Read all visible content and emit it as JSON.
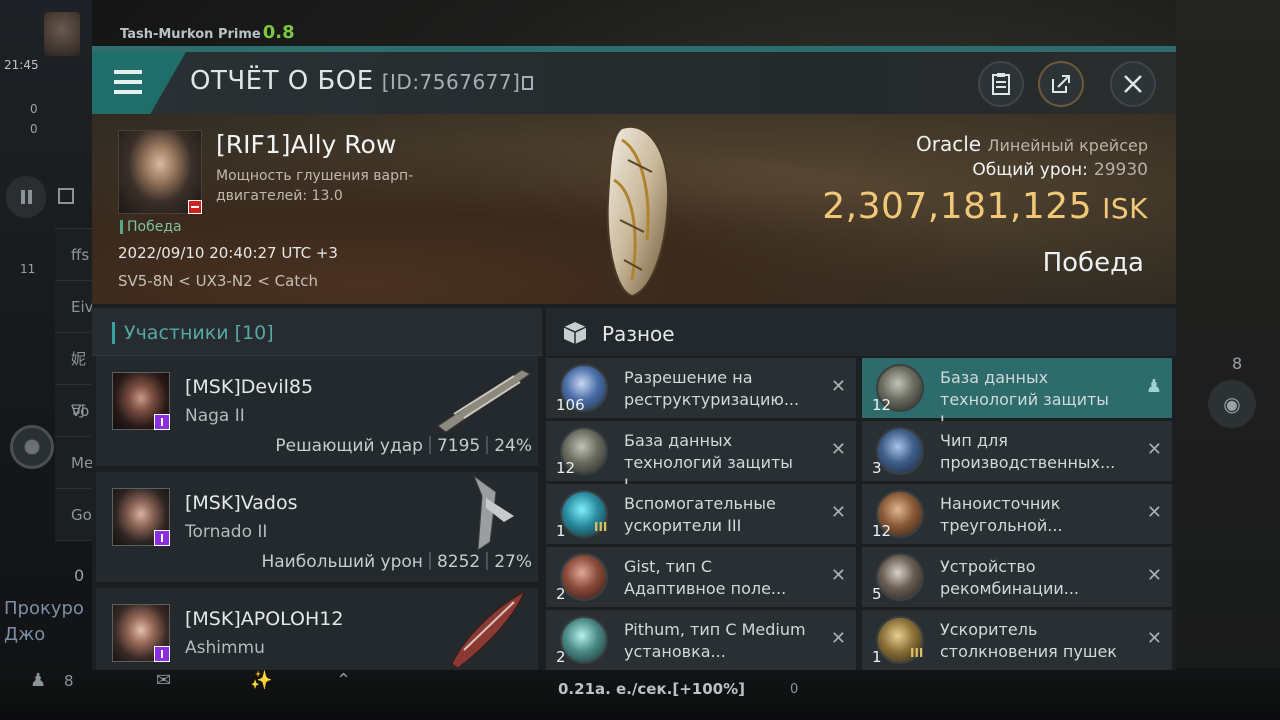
{
  "background": {
    "system_name": "Tash-Murkon Prime",
    "security": "0.8",
    "clock": "21:45",
    "counters": [
      "0",
      "0"
    ],
    "sidebar_items": [
      "ffs",
      "Eiv",
      "妮可",
      "Vo",
      "Me",
      "Go"
    ],
    "left_badge": "11",
    "chat_lines": [
      "Прокуро",
      "Джо"
    ],
    "chat_count": "0",
    "bottom_count": "8",
    "right_count": "8",
    "speed": "0.21а. е./сек.[+100%]",
    "speed_zero": "0"
  },
  "header": {
    "title": "ОТЧЁТ О БОЕ",
    "report_id": "[ID:7567677]"
  },
  "victim": {
    "name": "[RIF1]Ally Row",
    "attribute": "Мощность глушения варп-двигателей: 13.0",
    "outcome_tag": "Победа",
    "datetime": "2022/09/10 20:40:27 UTC +3",
    "location": "SV5-8N < UX3-N2 < Catch",
    "ship_name": "Oracle",
    "ship_type": "Линейный крейсер",
    "damage_label": "Общий урон:",
    "damage_value": "29930",
    "isk_value": "2,307,181,125",
    "isk_unit": "ISK",
    "result": "Победа"
  },
  "participants": {
    "title": "Участники",
    "count": "[10]",
    "list": [
      {
        "name": "[MSK]Devil85",
        "ship": "Naga II",
        "label": "Решающий удар",
        "damage": "7195",
        "percent": "24%"
      },
      {
        "name": "[MSK]Vados",
        "ship": "Tornado II",
        "label": "Наибольший урон",
        "damage": "8252",
        "percent": "27%"
      },
      {
        "name": "[MSK]APOLOH12",
        "ship": "Ashimmu",
        "label": "",
        "damage": "",
        "percent": ""
      }
    ]
  },
  "misc": {
    "title": "Разное",
    "items": [
      {
        "qty": "106",
        "name": "Разрешение на реструктуризацию...",
        "action": "✕",
        "level": ""
      },
      {
        "qty": "12",
        "name": "База данных технологий защиты I...",
        "action": "person",
        "level": ""
      },
      {
        "qty": "12",
        "name": "База данных технологий защиты I...",
        "action": "✕",
        "level": ""
      },
      {
        "qty": "3",
        "name": "Чип для производственных...",
        "action": "✕",
        "level": ""
      },
      {
        "qty": "1",
        "name": "Вспомогательные ускорители III",
        "action": "✕",
        "level": "III"
      },
      {
        "qty": "12",
        "name": "Наноисточник треугольной...",
        "action": "✕",
        "level": ""
      },
      {
        "qty": "2",
        "name": "Gist, тип C Адаптивное поле...",
        "action": "✕",
        "level": ""
      },
      {
        "qty": "5",
        "name": "Устройство рекомбинации...",
        "action": "✕",
        "level": ""
      },
      {
        "qty": "2",
        "name": "Pithum, тип C Medium установка...",
        "action": "✕",
        "level": ""
      },
      {
        "qty": "1",
        "name": "Ускоритель столкновения пушек ...",
        "action": "✕",
        "level": "III"
      }
    ]
  },
  "colors": {
    "accent": "#2f6c6c",
    "isk": "#f0c877",
    "selected_item": "#2d6c6a"
  }
}
